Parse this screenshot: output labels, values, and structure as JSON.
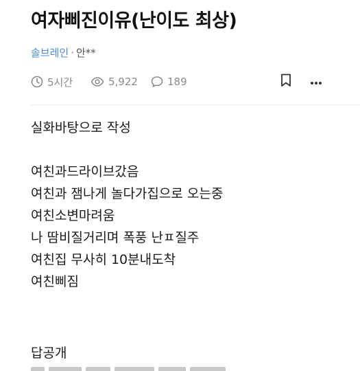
{
  "post": {
    "title": "여자삐진이유(난이도 최상)",
    "channel": "솔브레인",
    "separator": "·",
    "author": "안**"
  },
  "meta": {
    "time": "5시간",
    "views": "5,922",
    "comments": "189",
    "icons": {
      "time": "clock-icon",
      "views": "eye-icon",
      "comments": "comment-bubble-icon",
      "bookmark": "bookmark-icon",
      "more": "more-dots-icon"
    }
  },
  "body": {
    "intro": "실화바탕으로 작성",
    "lines": [
      "여친과드라이브갔음",
      "여친과 잼나게 놀다가집으로 오는중",
      "여친소변마려움",
      "나 땀비질거리며 폭풍 난ㅍ질주",
      "여친집 무사히 10분내도착",
      "여친삐짐"
    ],
    "answer_label": "답공개"
  },
  "colors": {
    "channel_link": "#4a8bd6",
    "meta_text": "#8a8a8a",
    "title": "#111111"
  }
}
